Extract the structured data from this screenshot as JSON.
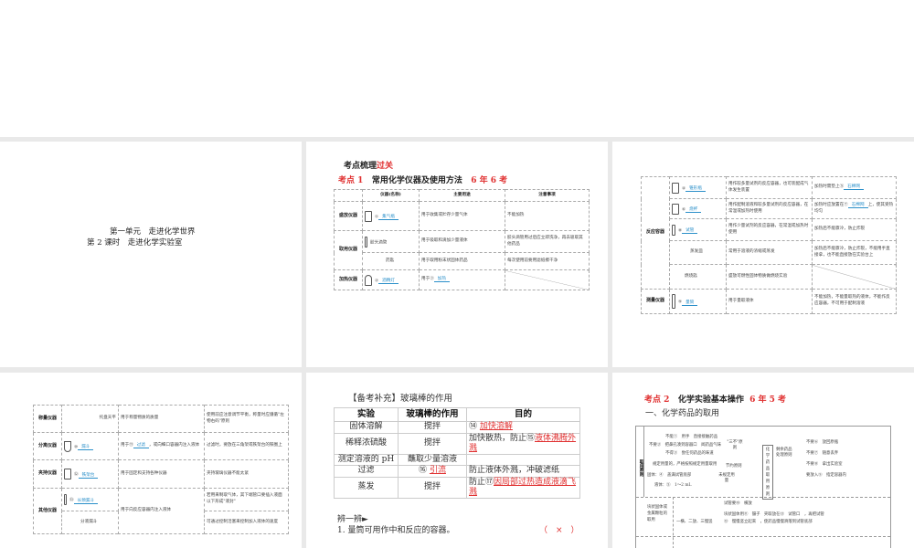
{
  "slide1": {
    "unit": "第一单元　走进化学世界",
    "lesson": "第 2 课时　走进化学实验室"
  },
  "slide2": {
    "heading_a": "考点梳理",
    "heading_b": "过关",
    "kp_label": "考点 1",
    "kp_title": "常用化学仪器及使用方法",
    "kp_freq": "6 年 6 考",
    "headers": [
      "仪器(名称)",
      "主要用途",
      "注意事项"
    ],
    "rows": [
      {
        "cat": "盛放仪器",
        "name": "①",
        "blank": "集气瓶",
        "use": "用于收集或贮存少量气体",
        "note": "不能加热"
      },
      {
        "cat": "取用仪器",
        "name": "胶头滴管",
        "use": "用于吸取和滴加少量液体",
        "note": "胶头滴管用过后应立即洗净，再去吸取其他药品"
      },
      {
        "name": "药匙",
        "use": "用于取用粉末状固体药品",
        "note": "每次使用前要用滤纸擦干净"
      },
      {
        "cat": "加热仪器",
        "name": "②",
        "blank": "酒精灯",
        "use": "用于③",
        "use_blank": "加热"
      }
    ]
  },
  "slide3": {
    "rows": [
      {
        "name": "④",
        "blank": "锥形瓶",
        "use": "用作较多量试剂的反应容器，也可装配成气体发生装置",
        "note": "加热时需垫上⑤",
        "note_blank": "石棉网"
      },
      {
        "name": "⑥",
        "blank": "烧杯",
        "use": "用作配制溶液和较多量试剂的反应容器，在常温或加热时使用",
        "note": "加热时应放置在⑦",
        "note_blank": "石棉网",
        "note_tail": "上，使其受热均匀"
      },
      {
        "name": "⑧",
        "blank": "试管",
        "use": "用作少量试剂的反应容器，在常温或加热时使用",
        "note": "加热后不能骤冷，防止炸裂"
      },
      {
        "name": "蒸发皿",
        "use": "常用于溶液的浓缩或蒸发",
        "note": "加热后不能骤冷，防止炸裂，不能用手直接拿，也不能直接放在实验台上"
      },
      {
        "name": "燃烧匙",
        "use": "盛放可燃性固体物质做燃烧实验"
      },
      {
        "cat": "测量仪器",
        "name": "⑨",
        "blank": "量筒",
        "use": "用于量取液体",
        "note": "不能加热，不能量取热的液体，不能作反应容器，不可用于配制溶液"
      }
    ],
    "cat_reaction": "反应容器"
  },
  "slide4": {
    "rows": [
      {
        "cat": "称量仪器",
        "name": "托盘天平",
        "use": "用于称量物质的质量",
        "note": "使用前应注意调节平衡，称量时应遵循\"左物右码\"原则"
      },
      {
        "cat": "分离仪器",
        "name": "⑩",
        "blank": "漏斗",
        "use": "用于⑪",
        "use_blank": "过滤",
        "use_tail": "，或向细口容器内注入液体",
        "note": "过滤时，要放在三角架或铁架台的铁圈上"
      },
      {
        "cat": "夹持仪器",
        "name": "⑫",
        "blank": "铁架台",
        "use": "用于固定和支持各种仪器",
        "note": "夹持玻璃仪器不能太紧"
      },
      {
        "cat": "其他仪器",
        "name": "⑬",
        "blank": "长颈漏斗",
        "use": "用于向反应容器内注入液体",
        "note": "若用来制取气体，其下端管口要插入液面以下形成\"液封\""
      },
      {
        "name": "分液漏斗",
        "note": "可通过控制活塞来控制加入液体的速度"
      }
    ]
  },
  "slide5": {
    "title": "【备考补充】玻璃棒的作用",
    "headers": [
      "实验",
      "玻璃棒的作用",
      "目的"
    ],
    "rows": [
      {
        "exp": "固体溶解",
        "role": "搅拌",
        "purpose": "⑭",
        "purpose_blank": "加快溶解"
      },
      {
        "exp": "稀释浓硫酸",
        "role": "搅拌",
        "purpose": "加快散热，防止⑮",
        "purpose_blank": "液体沸腾外溅"
      },
      {
        "exp": "测定溶液的 pH",
        "role": "蘸取少量溶液",
        "purpose": ""
      },
      {
        "exp": "过滤",
        "role": "⑯",
        "role_blank": "引流",
        "purpose": "防止液体外溅，冲破滤纸"
      },
      {
        "exp": "蒸发",
        "role": "搅拌",
        "purpose": "防止⑰",
        "purpose_blank": "因局部过热造成液滴飞溅"
      }
    ],
    "quiz_title": "辨一辨►",
    "quiz_item": "1. 量筒可用作中和反应的容器。",
    "quiz_paren": "（　×　）"
  },
  "slide6": {
    "kp_label": "考点 2",
    "kp_title": "化学实验基本操作",
    "kp_freq": "6 年 5 考",
    "section": "一、化学药品的取用",
    "side": "取用原则",
    "center": "化学药品取用原则",
    "three_no": "\"三不\"原则",
    "save": "节约原则",
    "unspecified": "未规定用量",
    "leftover": "剩余药品处理原则",
    "lines": [
      "不能①　用手　直接接触药品",
      "不要②　把鼻孔凑到容器口　闻药品气味",
      "不得③　尝任何药品的味道",
      "规定用量的，严格按照规定用量取用",
      "固体：④　盖满试管底部",
      "液体：⑤　1～2 mL"
    ],
    "right": [
      "不要⑥　放回原瓶",
      "不要⑦　随意丢弃",
      "不要⑧　拿出实验室",
      "要放入⑨　指定容器内"
    ],
    "row2_label": "块状固体或金属颗粒的取用",
    "row2": [
      "试管要⑩　横放",
      "块状固体用⑪　镊子　夹取放在⑫　试管口　，再把试管",
      "⑬　慢慢竖立起来　，使药品慢慢滑落到试管底部",
      "一横、二放、三慢竖"
    ]
  }
}
